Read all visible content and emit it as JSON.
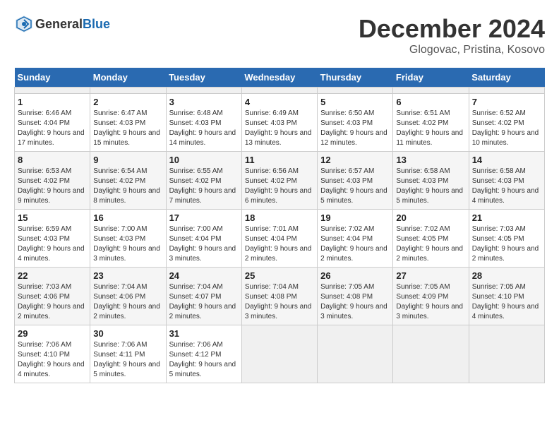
{
  "header": {
    "logo_general": "General",
    "logo_blue": "Blue",
    "month_title": "December 2024",
    "location": "Glogovac, Pristina, Kosovo"
  },
  "calendar": {
    "days_of_week": [
      "Sunday",
      "Monday",
      "Tuesday",
      "Wednesday",
      "Thursday",
      "Friday",
      "Saturday"
    ],
    "weeks": [
      [
        {
          "day": "",
          "empty": true
        },
        {
          "day": "",
          "empty": true
        },
        {
          "day": "",
          "empty": true
        },
        {
          "day": "",
          "empty": true
        },
        {
          "day": "",
          "empty": true
        },
        {
          "day": "",
          "empty": true
        },
        {
          "day": "",
          "empty": true
        }
      ],
      [
        {
          "day": "1",
          "sunrise": "Sunrise: 6:46 AM",
          "sunset": "Sunset: 4:04 PM",
          "daylight": "Daylight: 9 hours and 17 minutes."
        },
        {
          "day": "2",
          "sunrise": "Sunrise: 6:47 AM",
          "sunset": "Sunset: 4:03 PM",
          "daylight": "Daylight: 9 hours and 15 minutes."
        },
        {
          "day": "3",
          "sunrise": "Sunrise: 6:48 AM",
          "sunset": "Sunset: 4:03 PM",
          "daylight": "Daylight: 9 hours and 14 minutes."
        },
        {
          "day": "4",
          "sunrise": "Sunrise: 6:49 AM",
          "sunset": "Sunset: 4:03 PM",
          "daylight": "Daylight: 9 hours and 13 minutes."
        },
        {
          "day": "5",
          "sunrise": "Sunrise: 6:50 AM",
          "sunset": "Sunset: 4:03 PM",
          "daylight": "Daylight: 9 hours and 12 minutes."
        },
        {
          "day": "6",
          "sunrise": "Sunrise: 6:51 AM",
          "sunset": "Sunset: 4:02 PM",
          "daylight": "Daylight: 9 hours and 11 minutes."
        },
        {
          "day": "7",
          "sunrise": "Sunrise: 6:52 AM",
          "sunset": "Sunset: 4:02 PM",
          "daylight": "Daylight: 9 hours and 10 minutes."
        }
      ],
      [
        {
          "day": "8",
          "sunrise": "Sunrise: 6:53 AM",
          "sunset": "Sunset: 4:02 PM",
          "daylight": "Daylight: 9 hours and 9 minutes."
        },
        {
          "day": "9",
          "sunrise": "Sunrise: 6:54 AM",
          "sunset": "Sunset: 4:02 PM",
          "daylight": "Daylight: 9 hours and 8 minutes."
        },
        {
          "day": "10",
          "sunrise": "Sunrise: 6:55 AM",
          "sunset": "Sunset: 4:02 PM",
          "daylight": "Daylight: 9 hours and 7 minutes."
        },
        {
          "day": "11",
          "sunrise": "Sunrise: 6:56 AM",
          "sunset": "Sunset: 4:02 PM",
          "daylight": "Daylight: 9 hours and 6 minutes."
        },
        {
          "day": "12",
          "sunrise": "Sunrise: 6:57 AM",
          "sunset": "Sunset: 4:03 PM",
          "daylight": "Daylight: 9 hours and 5 minutes."
        },
        {
          "day": "13",
          "sunrise": "Sunrise: 6:58 AM",
          "sunset": "Sunset: 4:03 PM",
          "daylight": "Daylight: 9 hours and 5 minutes."
        },
        {
          "day": "14",
          "sunrise": "Sunrise: 6:58 AM",
          "sunset": "Sunset: 4:03 PM",
          "daylight": "Daylight: 9 hours and 4 minutes."
        }
      ],
      [
        {
          "day": "15",
          "sunrise": "Sunrise: 6:59 AM",
          "sunset": "Sunset: 4:03 PM",
          "daylight": "Daylight: 9 hours and 4 minutes."
        },
        {
          "day": "16",
          "sunrise": "Sunrise: 7:00 AM",
          "sunset": "Sunset: 4:03 PM",
          "daylight": "Daylight: 9 hours and 3 minutes."
        },
        {
          "day": "17",
          "sunrise": "Sunrise: 7:00 AM",
          "sunset": "Sunset: 4:04 PM",
          "daylight": "Daylight: 9 hours and 3 minutes."
        },
        {
          "day": "18",
          "sunrise": "Sunrise: 7:01 AM",
          "sunset": "Sunset: 4:04 PM",
          "daylight": "Daylight: 9 hours and 2 minutes."
        },
        {
          "day": "19",
          "sunrise": "Sunrise: 7:02 AM",
          "sunset": "Sunset: 4:04 PM",
          "daylight": "Daylight: 9 hours and 2 minutes."
        },
        {
          "day": "20",
          "sunrise": "Sunrise: 7:02 AM",
          "sunset": "Sunset: 4:05 PM",
          "daylight": "Daylight: 9 hours and 2 minutes."
        },
        {
          "day": "21",
          "sunrise": "Sunrise: 7:03 AM",
          "sunset": "Sunset: 4:05 PM",
          "daylight": "Daylight: 9 hours and 2 minutes."
        }
      ],
      [
        {
          "day": "22",
          "sunrise": "Sunrise: 7:03 AM",
          "sunset": "Sunset: 4:06 PM",
          "daylight": "Daylight: 9 hours and 2 minutes."
        },
        {
          "day": "23",
          "sunrise": "Sunrise: 7:04 AM",
          "sunset": "Sunset: 4:06 PM",
          "daylight": "Daylight: 9 hours and 2 minutes."
        },
        {
          "day": "24",
          "sunrise": "Sunrise: 7:04 AM",
          "sunset": "Sunset: 4:07 PM",
          "daylight": "Daylight: 9 hours and 2 minutes."
        },
        {
          "day": "25",
          "sunrise": "Sunrise: 7:04 AM",
          "sunset": "Sunset: 4:08 PM",
          "daylight": "Daylight: 9 hours and 3 minutes."
        },
        {
          "day": "26",
          "sunrise": "Sunrise: 7:05 AM",
          "sunset": "Sunset: 4:08 PM",
          "daylight": "Daylight: 9 hours and 3 minutes."
        },
        {
          "day": "27",
          "sunrise": "Sunrise: 7:05 AM",
          "sunset": "Sunset: 4:09 PM",
          "daylight": "Daylight: 9 hours and 3 minutes."
        },
        {
          "day": "28",
          "sunrise": "Sunrise: 7:05 AM",
          "sunset": "Sunset: 4:10 PM",
          "daylight": "Daylight: 9 hours and 4 minutes."
        }
      ],
      [
        {
          "day": "29",
          "sunrise": "Sunrise: 7:06 AM",
          "sunset": "Sunset: 4:10 PM",
          "daylight": "Daylight: 9 hours and 4 minutes."
        },
        {
          "day": "30",
          "sunrise": "Sunrise: 7:06 AM",
          "sunset": "Sunset: 4:11 PM",
          "daylight": "Daylight: 9 hours and 5 minutes."
        },
        {
          "day": "31",
          "sunrise": "Sunrise: 7:06 AM",
          "sunset": "Sunset: 4:12 PM",
          "daylight": "Daylight: 9 hours and 5 minutes."
        },
        {
          "day": "",
          "empty": true
        },
        {
          "day": "",
          "empty": true
        },
        {
          "day": "",
          "empty": true
        },
        {
          "day": "",
          "empty": true
        }
      ]
    ]
  }
}
